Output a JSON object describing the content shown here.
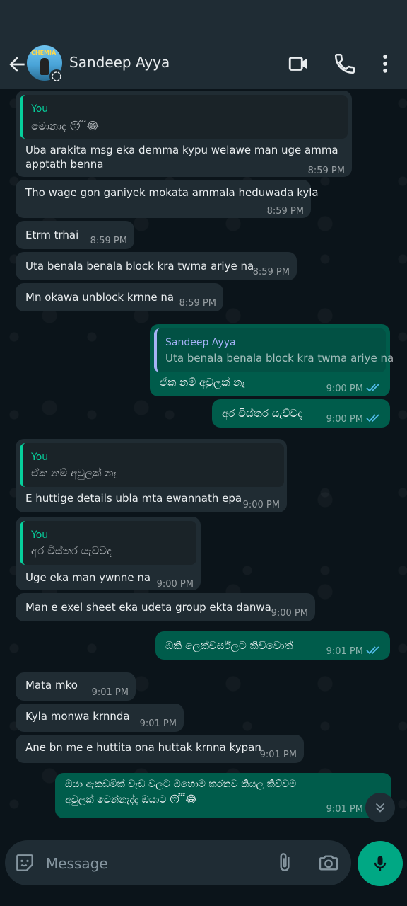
{
  "header": {
    "contact_name": "Sandeep Ayya",
    "avatar_text": "CHEMIA"
  },
  "messages": [
    {
      "quote_name": "You",
      "quote_text": "මොනාද 😴😂",
      "line1": "Uba arakita msg eka demma kypu welawe man uge amma",
      "line2": "apptath benna",
      "time": "8:59 PM"
    },
    {
      "text": "Tho wage gon ganiyek mokata ammala heduwada kyla",
      "time": "8:59 PM"
    },
    {
      "text": "Etrm trhai",
      "time": "8:59 PM"
    },
    {
      "text": "Uta benala benala block kra twma ariye na",
      "time": "8:59 PM"
    },
    {
      "text": "Mn okawa unblock krnne na",
      "time": "8:59 PM"
    },
    {
      "quote_name": "Sandeep Ayya",
      "quote_text": "Uta benala benala block kra twma ariye na",
      "text": "ඒක නම් අවුලක් නෑ",
      "time": "9:00 PM"
    },
    {
      "text": "අර විස්තර යැව්වද",
      "time": "9:00 PM"
    },
    {
      "quote_name": "You",
      "quote_text": "ඒක නම් අවුලක් නෑ",
      "text": "E huttige details ubla mta ewannath epa",
      "time": "9:00 PM"
    },
    {
      "quote_name": "You",
      "quote_text": "අර විස්තර යැව්වද",
      "text": "Uge eka man ywnne na",
      "time": "9:00 PM"
    },
    {
      "text": "Man e exel sheet eka udeta group ekta danwa",
      "time": "9:00 PM"
    },
    {
      "text": "ඔකි ලෙක්චර්ස්ලට කිව්වොත්",
      "time": "9:01 PM"
    },
    {
      "text": "Mata mko",
      "time": "9:01 PM"
    },
    {
      "text": "Kyla monwa krnnda",
      "time": "9:01 PM"
    },
    {
      "text": "Ane bn me e huttita ona huttak krnna kypan",
      "time": "9:01 PM"
    },
    {
      "line1": "ඔයා ඇකඩමික් වැඩ වලට ඔහොම කරනව කියල කිව්වම",
      "line2": "අවුලක් වෙන්නැද්ද ඔයාට 😴😂",
      "time": "9:01 PM"
    }
  ],
  "composer": {
    "placeholder": "Message"
  },
  "colors": {
    "incoming_bubble": "#202c33",
    "outgoing_bubble": "#005c4b",
    "accent": "#00a884",
    "read_ticks": "#53bdeb"
  },
  "icons": [
    "back-arrow-icon",
    "video-call-icon",
    "phone-icon",
    "more-options-icon",
    "sticker-icon",
    "attach-icon",
    "camera-icon",
    "mic-icon",
    "scroll-down-icon"
  ]
}
